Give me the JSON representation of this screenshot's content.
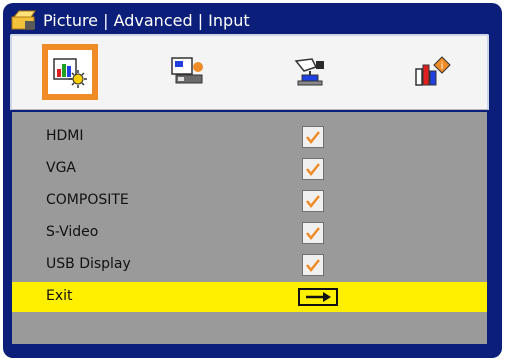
{
  "title": "Picture | Advanced | Input",
  "tabs": [
    {
      "name": "picture-tab",
      "icon": "picture-settings-icon"
    },
    {
      "name": "display-tab",
      "icon": "display-icon"
    },
    {
      "name": "setup-tab",
      "icon": "setup-hand-icon"
    },
    {
      "name": "info-tab",
      "icon": "info-icon"
    }
  ],
  "items": [
    {
      "label": "HDMI",
      "checked": true
    },
    {
      "label": "VGA",
      "checked": true
    },
    {
      "label": "COMPOSITE",
      "checked": true
    },
    {
      "label": "S-Video",
      "checked": true
    },
    {
      "label": "USB Display",
      "checked": true
    }
  ],
  "exit": {
    "label": "Exit",
    "icon": "right-arrow-icon"
  },
  "colors": {
    "frame": "#0a1e7a",
    "selection": "#fff000",
    "accent": "#f08c28",
    "check": "#f08c28",
    "list_bg": "#9a9a9a"
  }
}
